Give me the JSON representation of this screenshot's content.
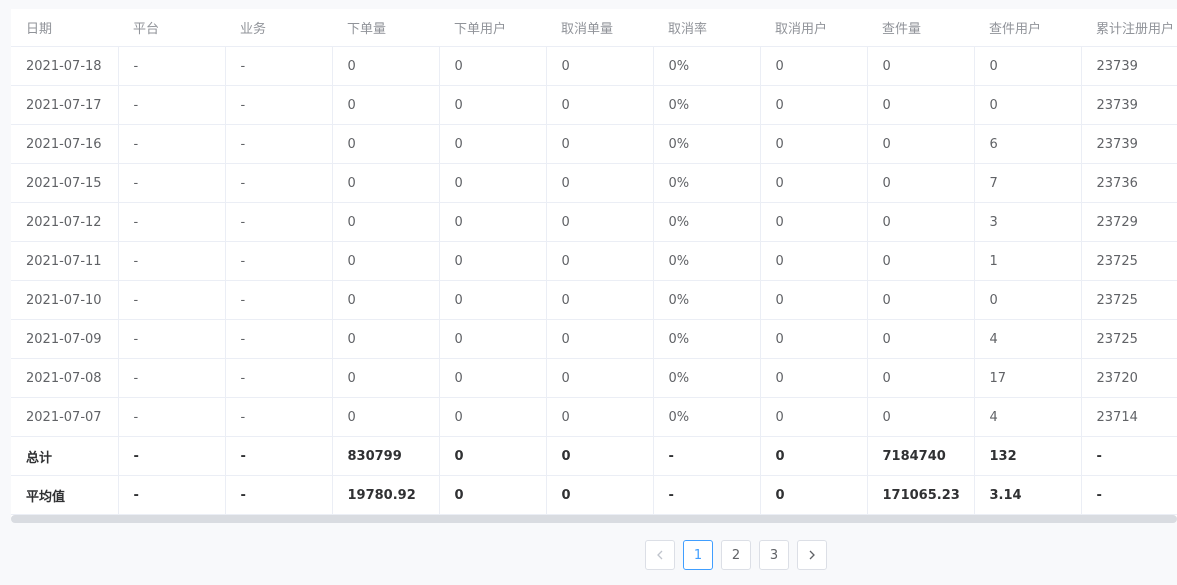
{
  "table": {
    "headers": [
      "日期",
      "平台",
      "业务",
      "下单量",
      "下单用户",
      "取消单量",
      "取消率",
      "取消用户",
      "查件量",
      "查件用户",
      "累计注册用户"
    ],
    "rows": [
      [
        "2021-07-18",
        "-",
        "-",
        "0",
        "0",
        "0",
        "0%",
        "0",
        "0",
        "0",
        "23739"
      ],
      [
        "2021-07-17",
        "-",
        "-",
        "0",
        "0",
        "0",
        "0%",
        "0",
        "0",
        "0",
        "23739"
      ],
      [
        "2021-07-16",
        "-",
        "-",
        "0",
        "0",
        "0",
        "0%",
        "0",
        "0",
        "6",
        "23739"
      ],
      [
        "2021-07-15",
        "-",
        "-",
        "0",
        "0",
        "0",
        "0%",
        "0",
        "0",
        "7",
        "23736"
      ],
      [
        "2021-07-12",
        "-",
        "-",
        "0",
        "0",
        "0",
        "0%",
        "0",
        "0",
        "3",
        "23729"
      ],
      [
        "2021-07-11",
        "-",
        "-",
        "0",
        "0",
        "0",
        "0%",
        "0",
        "0",
        "1",
        "23725"
      ],
      [
        "2021-07-10",
        "-",
        "-",
        "0",
        "0",
        "0",
        "0%",
        "0",
        "0",
        "0",
        "23725"
      ],
      [
        "2021-07-09",
        "-",
        "-",
        "0",
        "0",
        "0",
        "0%",
        "0",
        "0",
        "4",
        "23725"
      ],
      [
        "2021-07-08",
        "-",
        "-",
        "0",
        "0",
        "0",
        "0%",
        "0",
        "0",
        "17",
        "23720"
      ],
      [
        "2021-07-07",
        "-",
        "-",
        "0",
        "0",
        "0",
        "0%",
        "0",
        "0",
        "4",
        "23714"
      ]
    ],
    "summary_rows": [
      [
        "总计",
        "-",
        "-",
        "830799",
        "0",
        "0",
        "-",
        "0",
        "7184740",
        "132",
        "-"
      ],
      [
        "平均值",
        "-",
        "-",
        "19780.92",
        "0",
        "0",
        "-",
        "0",
        "171065.23",
        "3.14",
        "-"
      ]
    ]
  },
  "pagination": {
    "prev_icon": "chevron-left-icon",
    "next_icon": "chevron-right-icon",
    "pages": [
      "1",
      "2",
      "3"
    ],
    "current_page": "1"
  },
  "colors": {
    "accent": "#409eff",
    "header_text": "#909399",
    "cell_text": "#606266",
    "border": "#ebeef5",
    "page_bg": "#f8f9fb"
  }
}
